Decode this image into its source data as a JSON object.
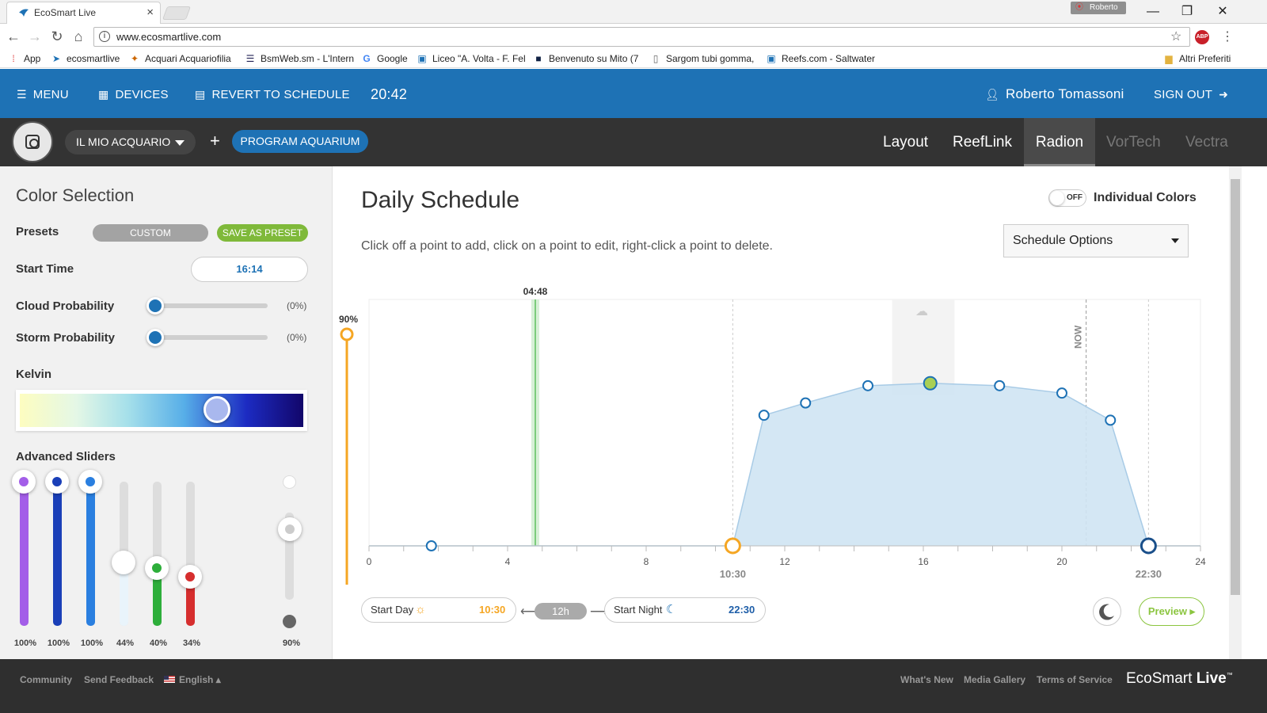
{
  "browser": {
    "tab_title": "EcoSmart Live",
    "user_chip": "Roberto",
    "url": "www.ecosmartlive.com",
    "bookmarks": [
      {
        "label": "App",
        "icon": "apps-grid-icon"
      },
      {
        "label": "ecosmartlive",
        "icon": "ecotech-icon"
      },
      {
        "label": "Acquari Acquariofilia",
        "icon": "fish-icon"
      },
      {
        "label": "BsmWeb.sm - L'Intern",
        "icon": "document-icon"
      },
      {
        "label": "Google",
        "icon": "google-icon"
      },
      {
        "label": "Liceo \"A. Volta - F. Fel",
        "icon": "school-icon"
      },
      {
        "label": "Benvenuto su Mito (7",
        "icon": "mito-icon"
      },
      {
        "label": "Sargom tubi gomma,",
        "icon": "page-icon"
      },
      {
        "label": "Reefs.com - Saltwater",
        "icon": "reefs-icon"
      }
    ],
    "other_bookmarks": "Altri Preferiti"
  },
  "header": {
    "menu": "MENU",
    "devices": "DEVICES",
    "revert": "REVERT TO SCHEDULE",
    "time": "20:42",
    "user": "Roberto Tomassoni",
    "signout": "SIGN OUT"
  },
  "subheader": {
    "aquarium": "IL MIO ACQUARIO",
    "add": "+",
    "program": "PROGRAM AQUARIUM",
    "tabs": [
      {
        "label": "Layout",
        "state": "normal"
      },
      {
        "label": "ReefLink",
        "state": "normal"
      },
      {
        "label": "Radion",
        "state": "active"
      },
      {
        "label": "VorTech",
        "state": "dim"
      },
      {
        "label": "Vectra",
        "state": "dim"
      }
    ]
  },
  "left": {
    "title": "Color Selection",
    "presets_label": "Presets",
    "preset_custom": "CUSTOM",
    "save_preset": "SAVE AS PRESET",
    "start_time_label": "Start Time",
    "start_time": "16:14",
    "cloud_label": "Cloud Probability",
    "cloud_value": "(0%)",
    "storm_label": "Storm Probability",
    "storm_value": "(0%)",
    "kelvin_label": "Kelvin",
    "advanced_label": "Advanced Sliders",
    "sliders": [
      {
        "label": "100%",
        "level": 1.0,
        "color": "#a35ee8"
      },
      {
        "label": "100%",
        "level": 1.0,
        "color": "#1a3fb8"
      },
      {
        "label": "100%",
        "level": 1.0,
        "color": "#2a7fe0"
      },
      {
        "label": "44%",
        "level": 0.44,
        "color": "#e9f4fb"
      },
      {
        "label": "40%",
        "level": 0.4,
        "color": "#2dae3a"
      },
      {
        "label": "34%",
        "level": 0.34,
        "color": "#d62e2e"
      },
      {
        "label": "90%",
        "level": 0.9,
        "color": "#cccccc"
      }
    ]
  },
  "main": {
    "title": "Daily Schedule",
    "hint": "Click off a point to add, click on a point to edit, right-click a point to delete.",
    "toggle": "OFF",
    "individual_colors": "Individual Colors",
    "schedule_options": "Schedule Options",
    "start_day_label": "Start Day",
    "start_day": "10:30",
    "duration": "12h",
    "start_night_label": "Start Night",
    "start_night": "22:30",
    "preview": "Preview"
  },
  "chart_data": {
    "type": "area",
    "x_ticks": [
      "0",
      "4",
      "8",
      "12",
      "16",
      "20",
      "24"
    ],
    "xlim": [
      0,
      24
    ],
    "ylim": [
      0,
      100
    ],
    "intensity_label": "90%",
    "cursor_time": "04:48",
    "now_label": "NOW",
    "sunrise_label": "10:30",
    "sunset_label": "22:30",
    "points": [
      {
        "x": 1.8,
        "y": 0
      },
      {
        "x": 10.5,
        "y": 0
      },
      {
        "x": 11.4,
        "y": 53
      },
      {
        "x": 12.6,
        "y": 58
      },
      {
        "x": 14.4,
        "y": 65
      },
      {
        "x": 16.2,
        "y": 66
      },
      {
        "x": 18.2,
        "y": 65
      },
      {
        "x": 20.0,
        "y": 62
      },
      {
        "x": 21.4,
        "y": 51
      },
      {
        "x": 22.5,
        "y": 0
      }
    ],
    "selected_time": 16.2,
    "now_time": 20.7,
    "cursor_x": 4.8
  },
  "footer": {
    "community": "Community",
    "feedback": "Send Feedback",
    "language": "English",
    "whats_new": "What's New",
    "gallery": "Media Gallery",
    "terms": "Terms of Service",
    "brand_a": "EcoSmart",
    "brand_b": "Live",
    "tm": "™"
  },
  "colors": {
    "brand_blue": "#1e72b5",
    "accent_orange": "#f5a623",
    "accent_green": "#8bc53f"
  }
}
